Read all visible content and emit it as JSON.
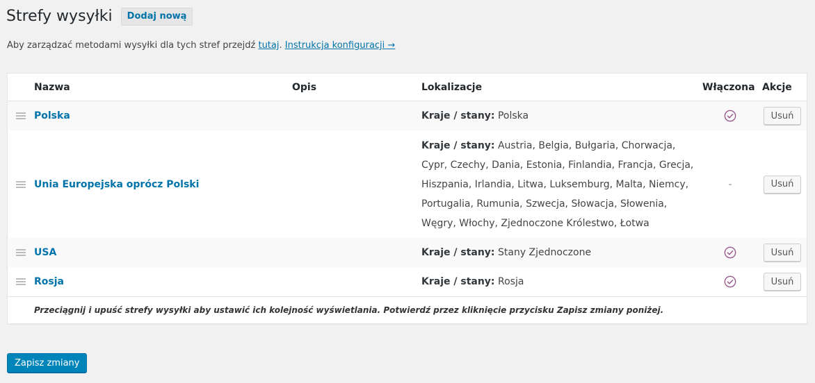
{
  "header": {
    "title": "Strefy wysyłki",
    "add_new": "Dodaj nową"
  },
  "intro": {
    "text": "Aby zarządzać metodami wysyłki dla tych stref przejdź ",
    "link_here": "tutaj",
    "separator": ". ",
    "link_docs": "Instrukcja konfiguracji →"
  },
  "table": {
    "columns": {
      "name": "Nazwa",
      "desc": "Opis",
      "locations": "Lokalizacje",
      "enabled": "Włączona",
      "actions": "Akcje"
    },
    "loc_label": "Kraje / stany:",
    "remove_label": "Usuń",
    "rows": [
      {
        "name": "Polska",
        "locations": "Polska",
        "enabled": true
      },
      {
        "name": "Unia Europejska oprócz Polski",
        "locations": "Austria, Belgia, Bułgaria, Chorwacja, Cypr, Czechy, Dania, Estonia, Finlandia, Francja, Grecja, Hiszpania, Irlandia, Litwa, Luksemburg, Malta, Niemcy, Portugalia, Rumunia, Szwecja, Słowacja, Słowenia, Węgry, Włochy, Zjednoczone Królestwo, Łotwa",
        "enabled": false,
        "disabled_text": "-"
      },
      {
        "name": "USA",
        "locations": "Stany Zjednoczone",
        "enabled": true
      },
      {
        "name": "Rosja",
        "locations": "Rosja",
        "enabled": true
      }
    ],
    "footer_note": "Przeciągnij i upuść strefy wysyłki aby ustawić ich kolejność wyświetlania. Potwierdź przez kliknięcie przycisku Zapisz zmiany poniżej."
  },
  "save_button": "Zapisz zmiany",
  "colors": {
    "accent": "#0073aa",
    "check": "#96588a",
    "primary_button": "#0085ba"
  }
}
